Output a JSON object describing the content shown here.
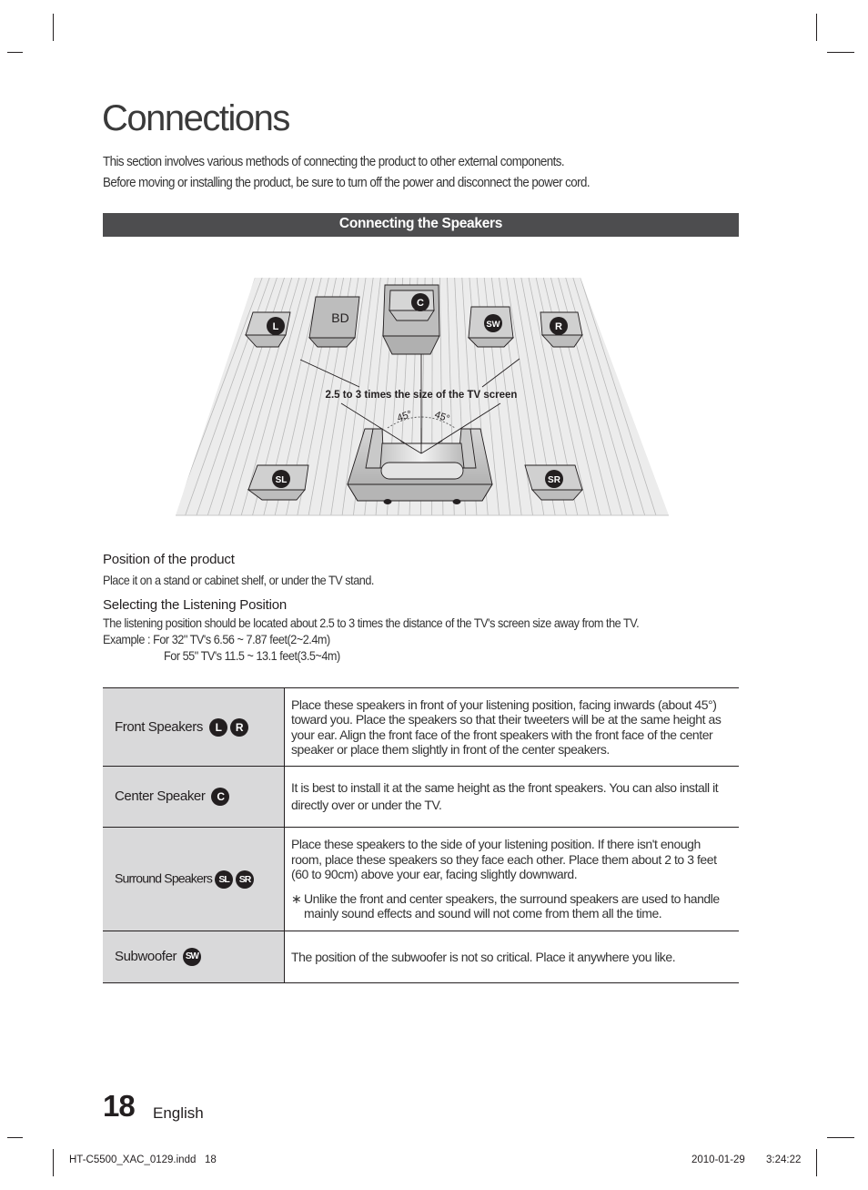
{
  "page": {
    "title": "Connections",
    "intro": [
      "This section involves various methods of connecting the product to other external components.",
      "Before moving or installing the product, be sure to turn off the power and disconnect the power cord."
    ],
    "section_heading": "Connecting the Speakers"
  },
  "diagram": {
    "distance_caption": "2.5 to 3 times the size of the TV screen",
    "angle_left": "45°",
    "angle_right": "45°",
    "labels": {
      "front_left": "L",
      "front_right": "R",
      "center": "C",
      "subwoofer": "SW",
      "surround_left": "SL",
      "surround_right": "SR",
      "player": "BD"
    }
  },
  "position": {
    "heading": "Position of the product",
    "text": "Place it on a stand or cabinet shelf, or under the TV stand."
  },
  "listening": {
    "heading": "Selecting the Listening Position",
    "text": "The listening position should be located about 2.5 to 3 times the distance of the TV's screen size away from the TV.",
    "example_1": "Example : For 32\" TV's 6.56 ~ 7.87 feet(2~2.4m)",
    "example_2": "For 55\" TV's 11.5 ~ 13.1 feet(3.5~4m)"
  },
  "table": {
    "rows": [
      {
        "name": "Front Speakers",
        "badges": [
          "L",
          "R"
        ],
        "description": "Place these speakers in front of your listening position, facing inwards (about 45°) toward you. Place the speakers so that their tweeters will be at the same height as your ear. Align the front face of the front speakers with the front face of the center speaker or place them slightly in front of the center speakers."
      },
      {
        "name": "Center Speaker",
        "badges": [
          "C"
        ],
        "description": "It is best to install it at the same height as the front speakers. You can also install it directly over or under the TV."
      },
      {
        "name": "Surround Speakers",
        "badges": [
          "SL",
          "SR"
        ],
        "description": "Place these speakers to the side of your listening position. If there isn't enough room, place these speakers so they face each other. Place them about 2 to 3 feet (60 to 90cm) above your ear, facing slightly downward.",
        "note_mark": "∗",
        "note": "Unlike the front and center speakers, the surround speakers are used to handle mainly sound effects and sound will not come from them all the time."
      },
      {
        "name": "Subwoofer",
        "badges": [
          "SW"
        ],
        "description": "The position of the subwoofer is not so critical. Place it anywhere you like."
      }
    ]
  },
  "footer": {
    "page_number": "18",
    "language": "English",
    "file": "HT-C5500_XAC_0129.indd   18",
    "date": "2010-01-29",
    "time": "3:24:22"
  },
  "colors": {
    "bar": "#4d4d4f",
    "cell": "#d9d9da",
    "ink": "#231f20"
  }
}
